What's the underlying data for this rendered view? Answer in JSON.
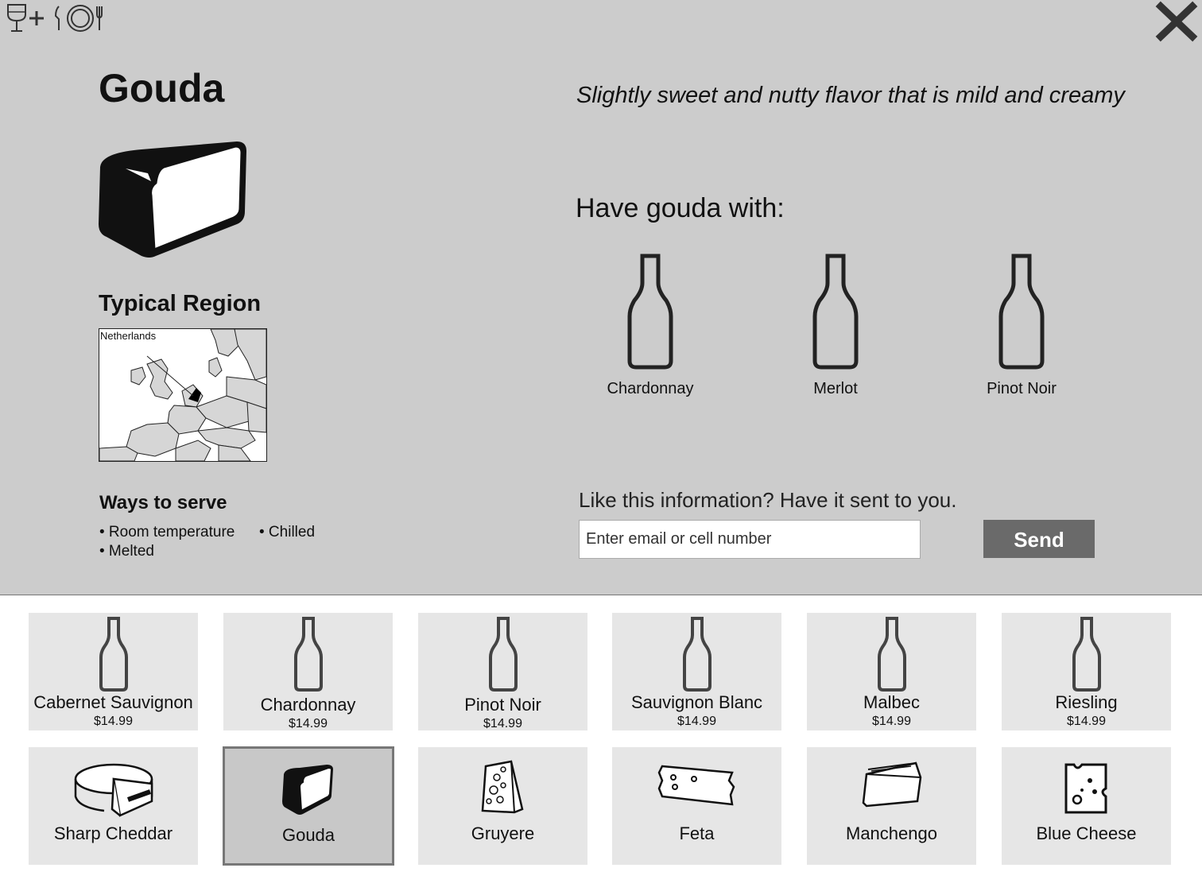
{
  "detail": {
    "title": "Gouda",
    "description": "Slightly sweet and nutty flavor that is mild and creamy",
    "region_title": "Typical Region",
    "region_name": "Netherlands",
    "serve_title": "Ways to serve",
    "serve_items": [
      "• Room temperature",
      "• Chilled",
      "• Melted"
    ],
    "pairing_title": "Have gouda with:",
    "pairings": [
      "Chardonnay",
      "Merlot",
      "Pinot Noir"
    ],
    "send_prompt": "Like this information? Have it sent to you.",
    "email_placeholder": "Enter email or cell number",
    "send_label": "Send"
  },
  "wines": [
    {
      "name": "Cabernet Sauvignon",
      "price": "$14.99"
    },
    {
      "name": "Chardonnay",
      "price": "$14.99"
    },
    {
      "name": "Pinot Noir",
      "price": "$14.99"
    },
    {
      "name": "Sauvignon Blanc",
      "price": "$14.99"
    },
    {
      "name": "Malbec",
      "price": "$14.99"
    },
    {
      "name": "Riesling",
      "price": "$14.99"
    }
  ],
  "cheeses": [
    {
      "name": "Sharp Cheddar",
      "icon": "cheddar-wheel-icon"
    },
    {
      "name": "Gouda",
      "icon": "gouda-block-icon",
      "selected": true
    },
    {
      "name": "Gruyere",
      "icon": "gruyere-wedge-icon"
    },
    {
      "name": "Feta",
      "icon": "feta-block-icon"
    },
    {
      "name": "Manchengo",
      "icon": "manchego-wedge-icon"
    },
    {
      "name": "Blue Cheese",
      "icon": "blue-cheese-icon"
    }
  ],
  "colors": {
    "panel": "#cccccc",
    "tile": "#e6e6e6",
    "tile_selected": "#c8c8c8",
    "send_button": "#6a6a6a"
  }
}
